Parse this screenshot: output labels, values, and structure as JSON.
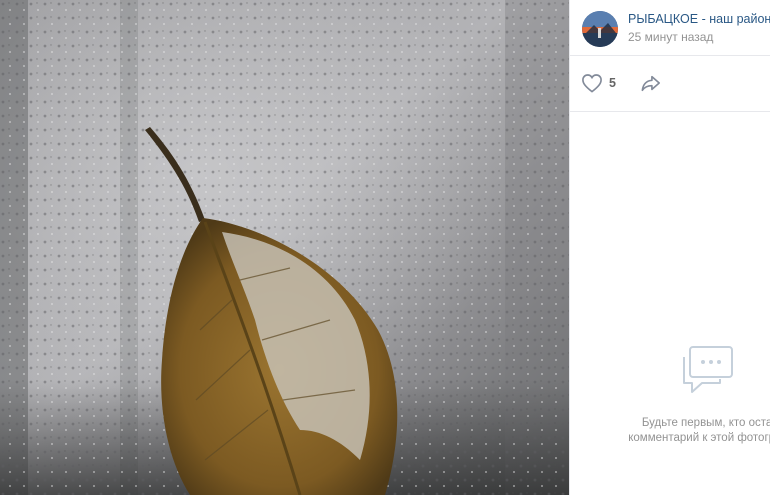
{
  "photo": {
    "description_icon": "autumn-leaf-on-rainy-window"
  },
  "post": {
    "group_name": "РЫБАЦКОЕ - наш район!",
    "time": "25 минут назад",
    "likes": "5"
  },
  "comments": {
    "empty_line1": "Будьте первым, кто оставит",
    "empty_line2": "комментарий к этой фотографии"
  },
  "colors": {
    "link": "#2a5885",
    "muted": "#939393",
    "divider": "#e7e8ec",
    "icon": "#828a99",
    "empty_icon": "#c5d0db"
  }
}
